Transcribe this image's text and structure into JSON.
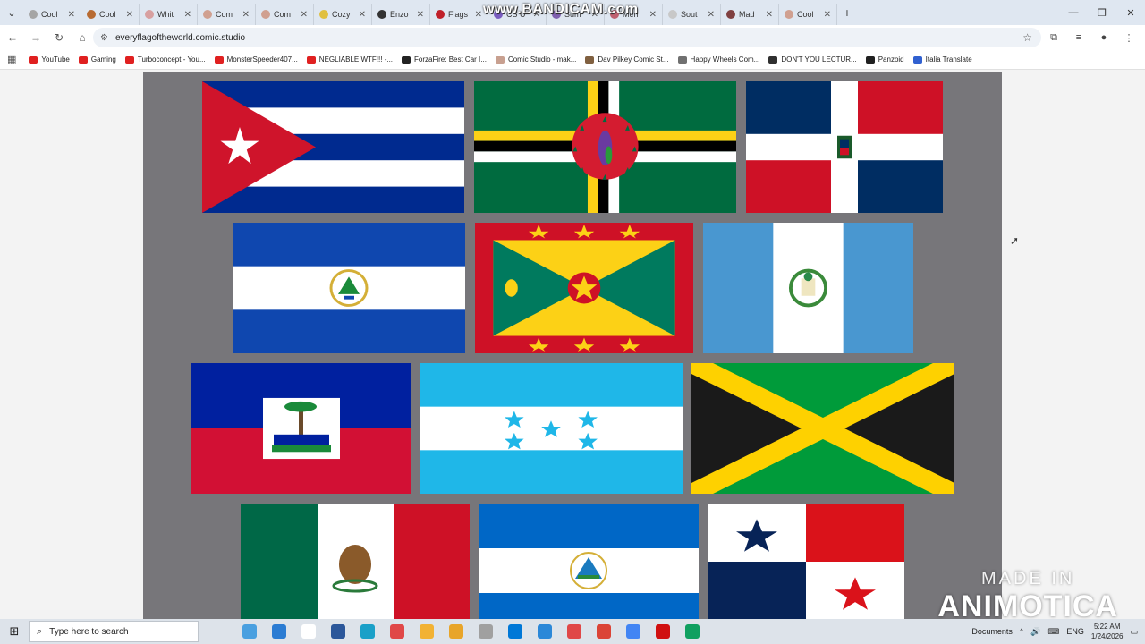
{
  "browser": {
    "watermark": "www.BANDICAM.com",
    "tabs": [
      {
        "title": "Cool",
        "color": "#a5a5a5"
      },
      {
        "title": "Cool",
        "color": "#b86b32"
      },
      {
        "title": "Whit",
        "color": "#d8a0a0"
      },
      {
        "title": "Com",
        "color": "#d0a090"
      },
      {
        "title": "Com",
        "color": "#d0a090"
      },
      {
        "title": "Cozy",
        "color": "#e0c040"
      },
      {
        "title": "Enzo",
        "color": "#333333"
      },
      {
        "title": "Flags",
        "color": "#c0202a"
      },
      {
        "title": "CS U",
        "color": "#7a5cc0"
      },
      {
        "title": "Sum",
        "color": "#8060b0"
      },
      {
        "title": "Men",
        "color": "#c06070"
      },
      {
        "title": "Sout",
        "color": "#c8c8c8"
      },
      {
        "title": "Mad",
        "color": "#804040"
      },
      {
        "title": "Cool",
        "color": "#d0a090"
      }
    ],
    "url": "everyflagoftheworld.comic.studio",
    "bookmarks": [
      {
        "label": "YouTube",
        "color": "#e02020"
      },
      {
        "label": "Gaming",
        "color": "#e02020"
      },
      {
        "label": "Turboconcept - You...",
        "color": "#e02020"
      },
      {
        "label": "MonsterSpeeder407...",
        "color": "#e02020"
      },
      {
        "label": "NEGLIABLE WTF!!! -...",
        "color": "#e02020"
      },
      {
        "label": "ForzaFire: Best Car I...",
        "color": "#222222"
      },
      {
        "label": "Comic Studio - mak...",
        "color": "#c8a090"
      },
      {
        "label": "Dav Pilkey Comic St...",
        "color": "#806040"
      },
      {
        "label": "Happy Wheels Com...",
        "color": "#707070"
      },
      {
        "label": "DON'T YOU LECTUR...",
        "color": "#303030"
      },
      {
        "label": "Panzoid",
        "color": "#202020"
      },
      {
        "label": "Italia Translate",
        "color": "#3060d0"
      }
    ]
  },
  "page": {
    "flags": [
      {
        "country": "cuba"
      },
      {
        "country": "dominica"
      },
      {
        "country": "dominican-republic"
      },
      {
        "country": "el-salvador"
      },
      {
        "country": "grenada"
      },
      {
        "country": "guatemala"
      },
      {
        "country": "haiti"
      },
      {
        "country": "honduras"
      },
      {
        "country": "jamaica"
      },
      {
        "country": "mexico"
      },
      {
        "country": "nicaragua"
      },
      {
        "country": "panama"
      }
    ],
    "overlay_line1": "MADE IN",
    "overlay_line2": "ANIMOTICA"
  },
  "taskbar": {
    "search_placeholder": "Type here to search",
    "apps": [
      "#4aa0e0",
      "#2b7cd3",
      "#ffffff",
      "#2b579a",
      "#1aa0c8",
      "#e04848",
      "#f2b233",
      "#e8a52a",
      "#a0a0a0",
      "#0078d7",
      "#2b88d8",
      "#e04848",
      "#db4437",
      "#4285f4",
      "#d01010",
      "#10a060"
    ],
    "tray_label": "Documents",
    "lang": "ENG",
    "time": "5:22 AM",
    "date": "1/24/2026"
  }
}
